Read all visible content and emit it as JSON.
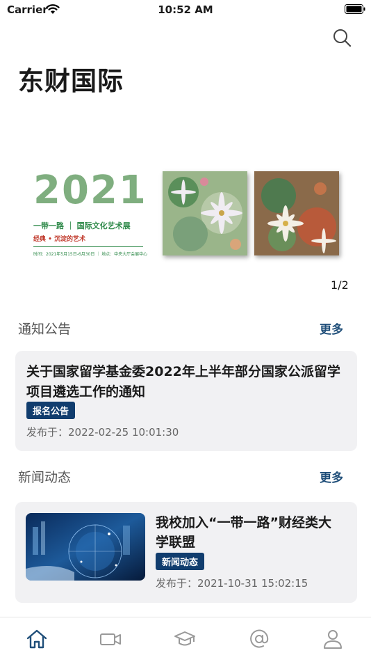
{
  "status_bar": {
    "carrier": "Carrier",
    "time": "10:52 AM"
  },
  "header": {
    "title": "东财国际",
    "search_icon": "search-icon"
  },
  "banner": {
    "year": "2021",
    "subtitle": "一带一路 ｜ 国际文化艺术展",
    "tagline": "经典 • 沉淀的艺术",
    "date_info": "时间：2021年5月15日-6月30日 ｜ 地点：中央大厅会展中心",
    "pager": "1/2"
  },
  "notices": {
    "section_title": "通知公告",
    "more_label": "更多",
    "item": {
      "title": "关于国家留学基金委2022年上半年部分国家公派留学项目遴选工作的通知",
      "tag": "报名公告",
      "date": "发布于：2022-02-25 10:01:30"
    }
  },
  "news": {
    "section_title": "新闻动态",
    "more_label": "更多",
    "item": {
      "title": "我校加入“一带一路”财经类大学联盟",
      "tag": "新闻动态",
      "date": "发布于：2021-10-31 15:02:15"
    }
  },
  "tabbar": {
    "items": [
      {
        "icon": "home-icon",
        "active": true
      },
      {
        "icon": "video-icon",
        "active": false
      },
      {
        "icon": "graduation-cap-icon",
        "active": false
      },
      {
        "icon": "at-icon",
        "active": false
      },
      {
        "icon": "user-icon",
        "active": false
      }
    ]
  },
  "colors": {
    "accent": "#1f4e79",
    "tag_bg": "#113d6e",
    "card_bg": "#f1f1f3",
    "active_tab": "#1f4e79",
    "inactive_tab": "#999999"
  }
}
